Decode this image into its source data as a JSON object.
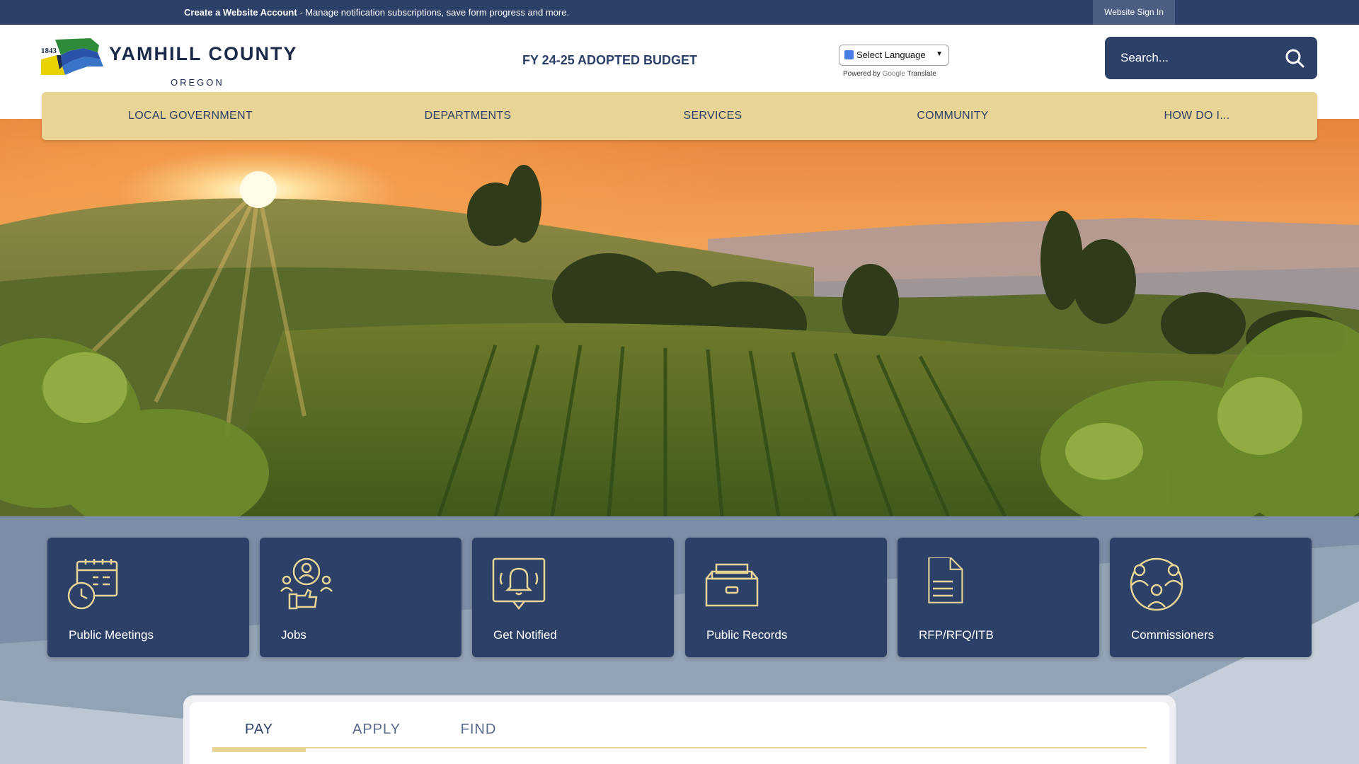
{
  "top_bar": {
    "account_link": "Create a Website Account",
    "account_message": " - Manage notification subscriptions, save form progress and more.",
    "sign_in": "Website Sign In"
  },
  "header": {
    "logo": {
      "year": "1843",
      "name": "YAMHILL COUNTY",
      "state": "OREGON"
    },
    "featured_link": "FY 24-25 ADOPTED BUDGET",
    "translate": {
      "select_label": "Select Language",
      "powered_by": "Powered by",
      "google": "Google",
      "translate": "Translate"
    },
    "search": {
      "placeholder": "Search..."
    }
  },
  "nav": {
    "items": [
      {
        "label": "LOCAL GOVERNMENT"
      },
      {
        "label": "DEPARTMENTS"
      },
      {
        "label": "SERVICES"
      },
      {
        "label": "COMMUNITY"
      },
      {
        "label": "HOW DO I..."
      }
    ]
  },
  "quick_links": [
    {
      "label": "Public Meetings",
      "icon": "calendar-clock-icon"
    },
    {
      "label": "Jobs",
      "icon": "jobs-people-icon"
    },
    {
      "label": "Get Notified",
      "icon": "bell-notification-icon"
    },
    {
      "label": "Public Records",
      "icon": "archive-box-icon"
    },
    {
      "label": "RFP/RFQ/ITB",
      "icon": "document-icon"
    },
    {
      "label": "Commissioners",
      "icon": "people-group-icon"
    }
  ],
  "tabs": {
    "items": [
      {
        "label": "PAY",
        "active": true
      },
      {
        "label": "APPLY",
        "active": false
      },
      {
        "label": "FIND",
        "active": false
      }
    ]
  },
  "colors": {
    "navy": "#2d4168",
    "gold": "#e8d596",
    "slate": "#7c8ea7"
  }
}
